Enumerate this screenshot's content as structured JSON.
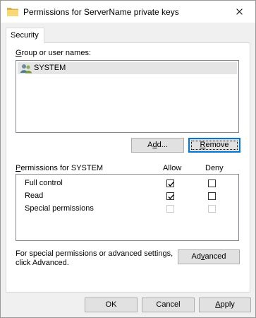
{
  "window": {
    "title": "Permissions for ServerName private keys"
  },
  "tabs": [
    {
      "label": "Security"
    }
  ],
  "groups": {
    "label_prefix": "G",
    "label_rest": "roup or user names:",
    "items": [
      {
        "label": "SYSTEM",
        "icon": "users-icon"
      }
    ]
  },
  "buttons": {
    "add_a": "A",
    "add_d": "d",
    "add_rest": "d...",
    "remove_r": "R",
    "remove_rest": "emove",
    "advanced_pre": "Ad",
    "advanced_v": "v",
    "advanced_rest": "anced",
    "ok": "OK",
    "cancel": "Cancel",
    "apply_a": "A",
    "apply_rest": "pply"
  },
  "permissions": {
    "header_p": "P",
    "header_rest": "ermissions for SYSTEM",
    "allow_header": "Allow",
    "deny_header": "Deny",
    "rows": [
      {
        "name": "Full control",
        "allow": true,
        "deny": false,
        "disabled": false
      },
      {
        "name": "Read",
        "allow": true,
        "deny": false,
        "disabled": false
      },
      {
        "name": "Special permissions",
        "allow": false,
        "deny": false,
        "disabled": true
      }
    ]
  },
  "advanced_note": {
    "line1": "For special permissions or advanced settings,",
    "line2": "click Advanced."
  }
}
